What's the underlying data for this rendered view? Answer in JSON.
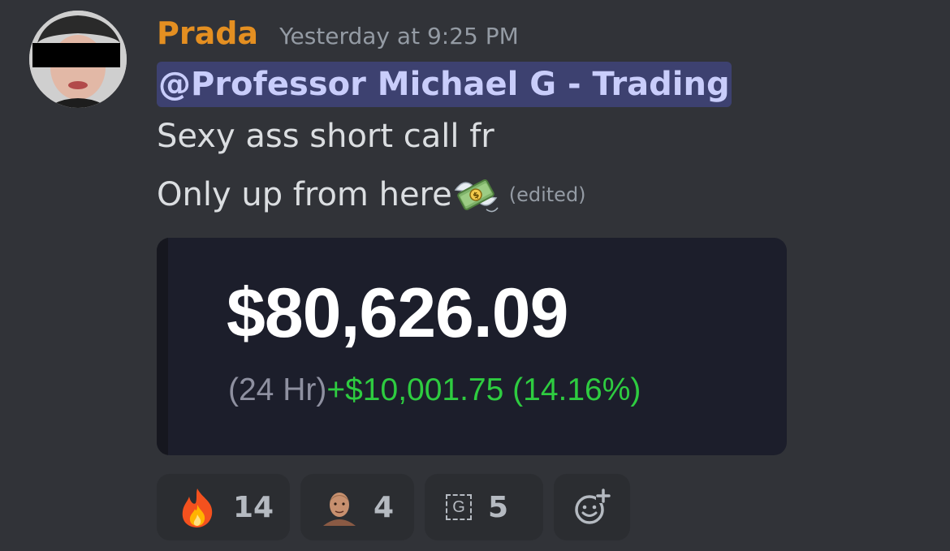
{
  "message": {
    "username": "Prada",
    "timestamp": "Yesterday at 9:25 PM",
    "mention": "@Professor Michael G - Trading",
    "line1": "Sexy ass short call fr",
    "line2": "Only up from here",
    "edited": "(edited)",
    "emoji": "money-with-wings"
  },
  "embed": {
    "price": "$80,626.09",
    "period": "(24 Hr)",
    "change": "+$10,001.75 (14.16%)"
  },
  "reactions": [
    {
      "emoji": "fire-icon",
      "count": "14"
    },
    {
      "emoji": "person-face-icon",
      "count": "4"
    },
    {
      "emoji": "G",
      "count": "5"
    }
  ],
  "colors": {
    "background": "#313338",
    "username": "#e48f21",
    "mention_bg": "rgba(88,101,242,0.30)",
    "positive": "#2ecc40"
  }
}
